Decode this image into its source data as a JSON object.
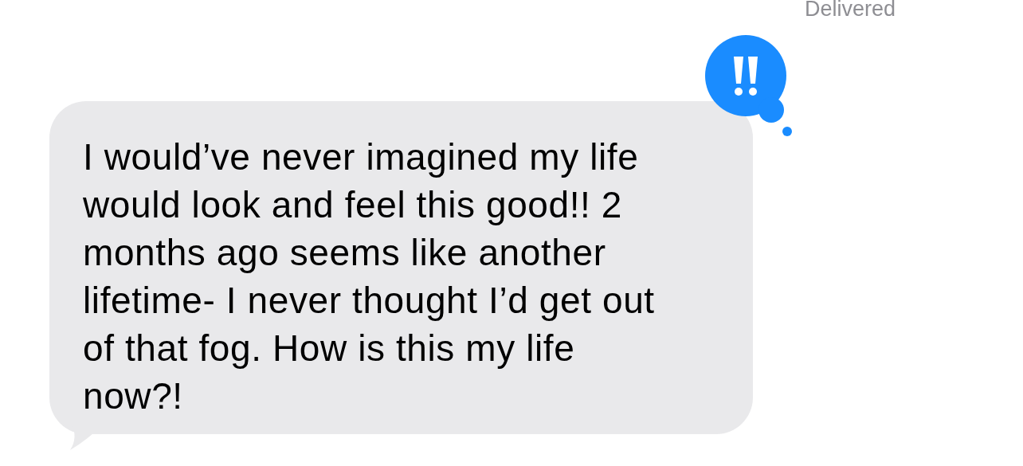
{
  "status": "Delivered",
  "message": {
    "lines": [
      "I would’ve never imagined my life",
      "would look and feel this good!! 2",
      "months ago seems like another",
      "lifetime- I never thought I’d get out",
      "of that fog. How is this my life",
      "now?!"
    ],
    "emphasized": true
  }
}
